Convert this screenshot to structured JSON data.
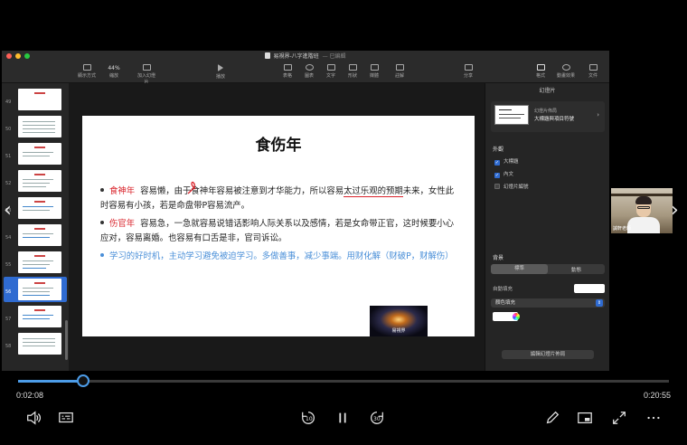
{
  "window": {
    "title": "易視界-八字進階班",
    "subtitle": "— 已編輯"
  },
  "toolbar": {
    "items": [
      {
        "label": "顯示方式"
      },
      {
        "label": "縮放",
        "value": "44%"
      },
      {
        "label": "加入幻燈片"
      },
      {
        "label": "播放"
      },
      {
        "label": "表格"
      },
      {
        "label": "圖表"
      },
      {
        "label": "文字"
      },
      {
        "label": "形狀"
      },
      {
        "label": "媒體"
      },
      {
        "label": "註解"
      },
      {
        "label": "分享"
      },
      {
        "label": "格式"
      },
      {
        "label": "動畫效果"
      },
      {
        "label": "文件"
      }
    ]
  },
  "navigator": {
    "thumbs": [
      {
        "num": "49"
      },
      {
        "num": "50"
      },
      {
        "num": "51"
      },
      {
        "num": "52"
      },
      {
        "num": "53"
      },
      {
        "num": "54"
      },
      {
        "num": "55"
      },
      {
        "num": "56"
      },
      {
        "num": "57"
      },
      {
        "num": "58"
      }
    ],
    "selected_index": 7
  },
  "slide": {
    "title": "食伤年",
    "bullets": [
      {
        "keyword": "食神年",
        "text_a": "容易懒，由于食神年容易被注意到才华能力，所以容易",
        "text_under": "太过乐观的预期",
        "text_b": "未来，女性此时容易有小孩，若是命盘带P容易流产。"
      },
      {
        "keyword": "伤官年",
        "text": "容易急，一急就容易说错话影响人际关系以及感情，若是女命带正官，这时候要小心应对，容易离婚。也容易有口舌是非，官司诉讼。"
      },
      {
        "text": "学习的好时机，主动学习避免被迫学习。多做善事，减少事端。用财化解（财破P，财解伤）"
      }
    ],
    "logo_text": "易視界"
  },
  "inspector": {
    "header": "幻燈片",
    "layout_label": "幻燈片佈局",
    "layout_name": "大標題與項目符號",
    "appearance_title": "外觀",
    "checks": [
      {
        "label": "大標題",
        "checked": true
      },
      {
        "label": "內文",
        "checked": true
      },
      {
        "label": "幻燈片編號",
        "checked": false
      }
    ],
    "background_title": "背景",
    "seg_options": [
      "標準",
      "動態"
    ],
    "seg_selected": 0,
    "dynamic_fill_label": "自動填充",
    "fill_select": "顏色填充",
    "edit_button": "編輯幻燈片佈局"
  },
  "webcam": {
    "label": "誠軒老師"
  },
  "player": {
    "current_time": "0:02:08",
    "total_time": "0:20:55",
    "progress": 0.1,
    "skip_back": "10",
    "skip_forward": "30"
  },
  "colors": {
    "accent": "#4c9ce8",
    "keyword_red": "#d9232b",
    "advice_blue": "#4a8fd8",
    "selection": "#2f6bd1"
  }
}
